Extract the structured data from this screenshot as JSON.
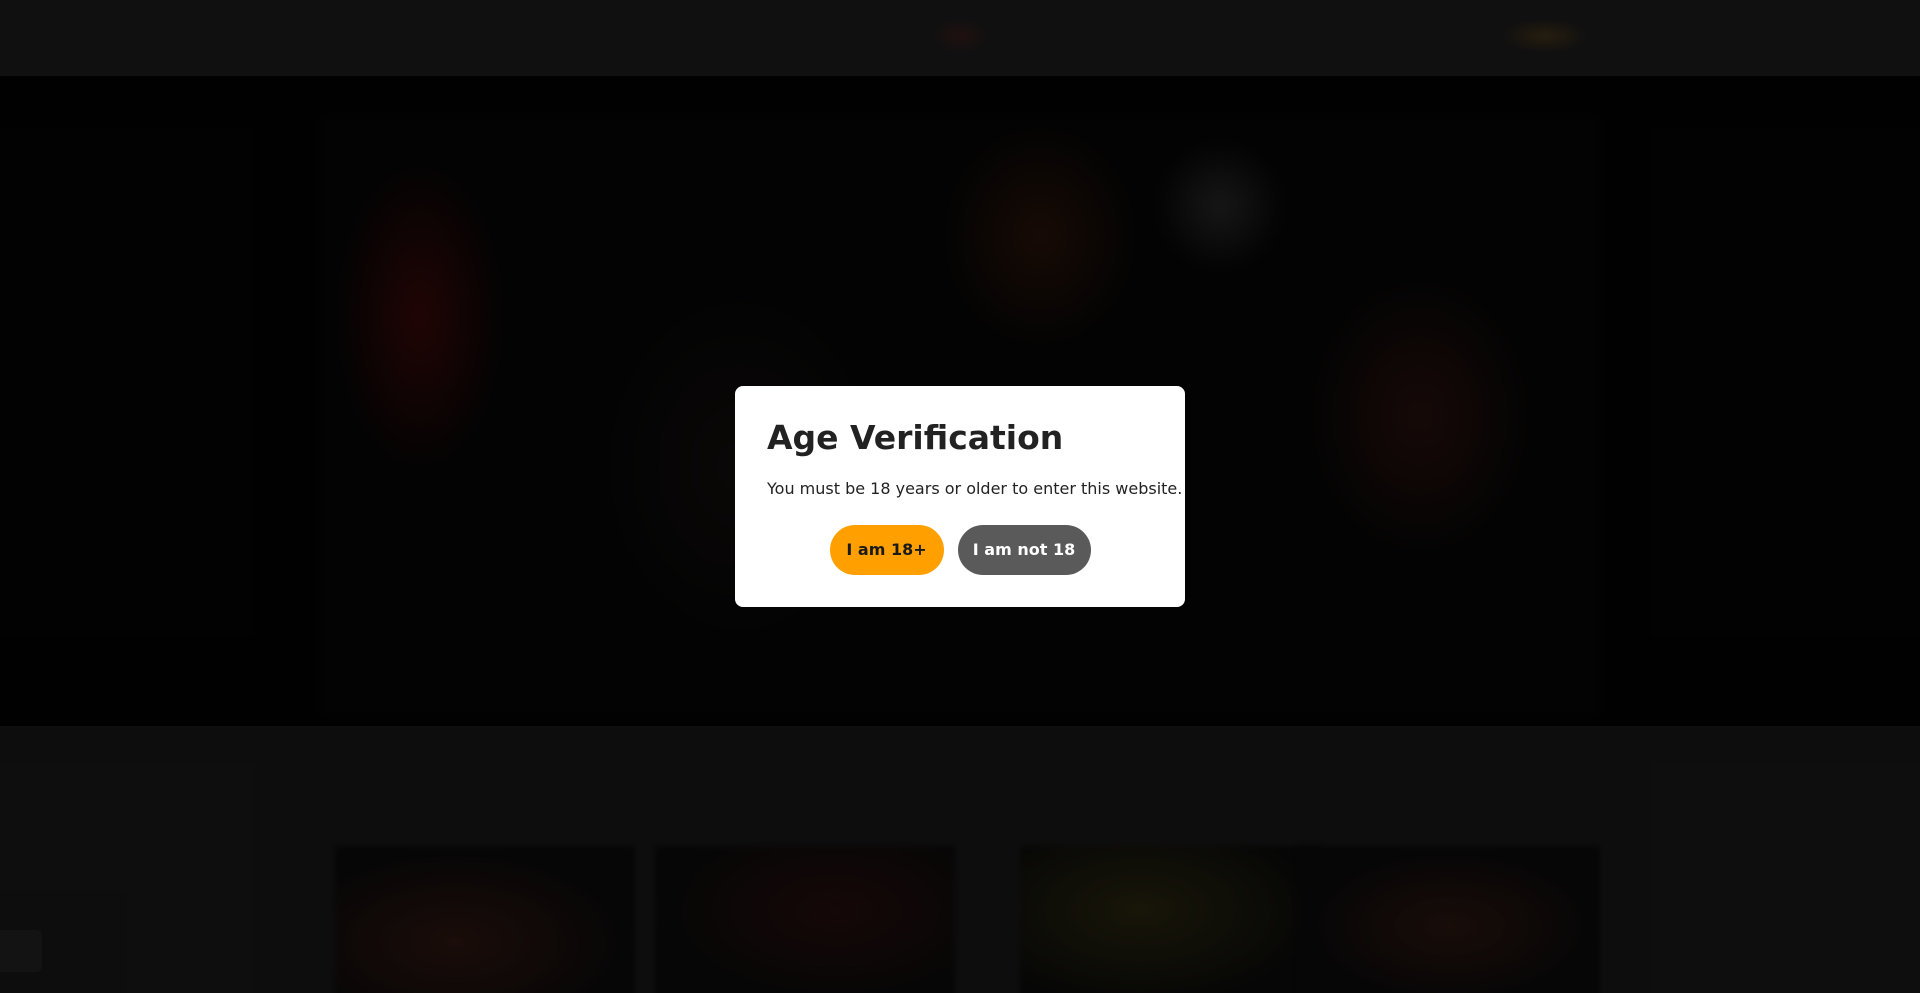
{
  "modal": {
    "title": "Age Verification",
    "message": "You must be 18 years or older to enter this website.",
    "confirm_label": "I am 18+",
    "deny_label": "I am not 18"
  },
  "colors": {
    "confirm_button": "#ffa000",
    "deny_button": "#5a5a5a",
    "modal_background": "#ffffff",
    "page_background": "#151515"
  }
}
